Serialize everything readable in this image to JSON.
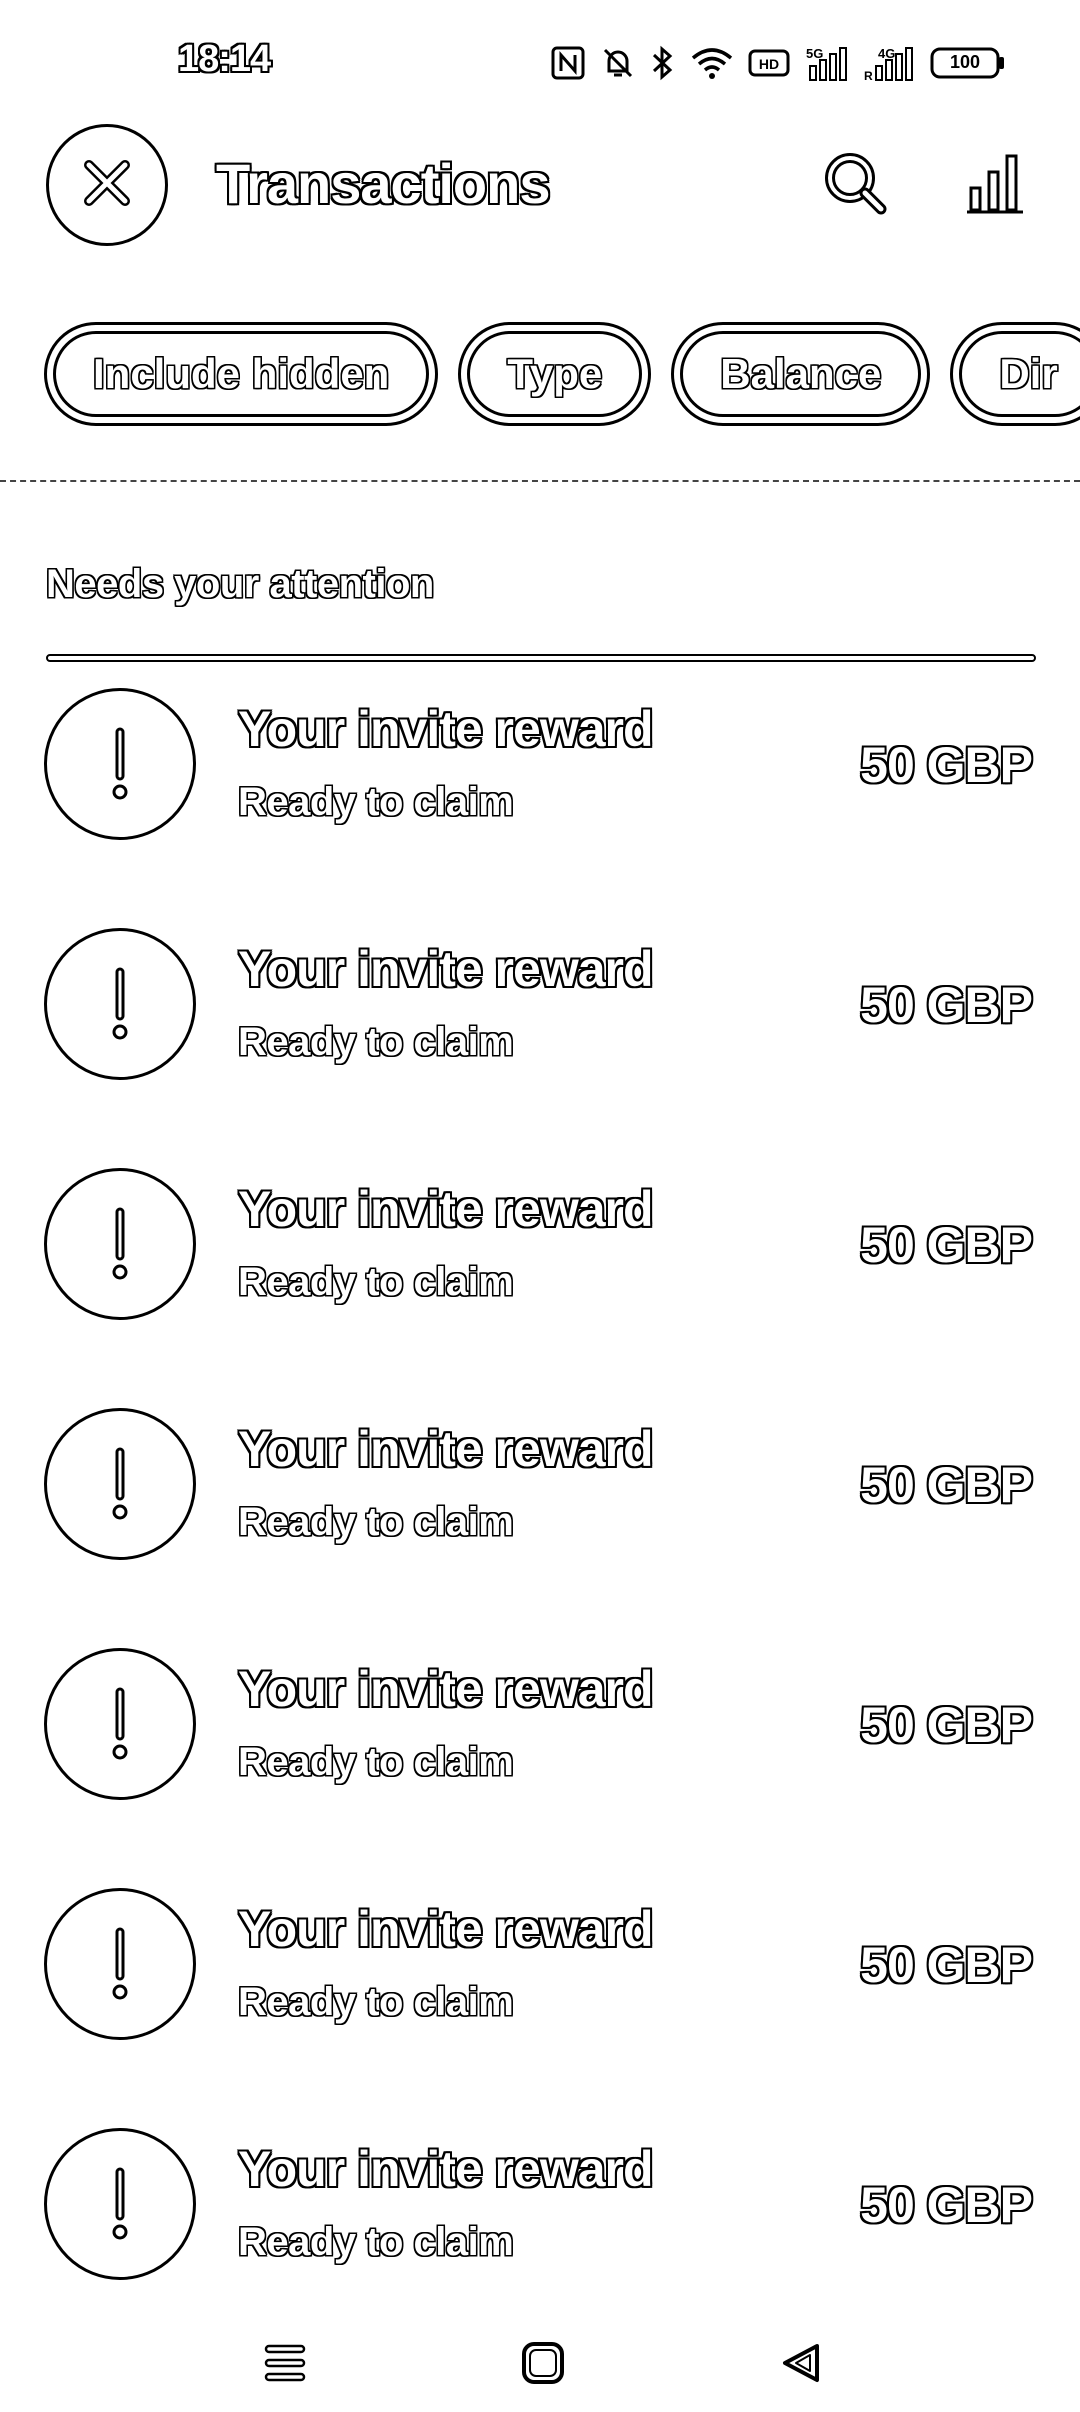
{
  "status_bar": {
    "time": "18:14",
    "icons": [
      "nfc-icon",
      "mute-icon",
      "bluetooth-icon",
      "wifi-icon",
      "hd-icon",
      "signal-5g-icon",
      "signal-4g-icon",
      "battery-icon"
    ],
    "battery": "100"
  },
  "app_bar": {
    "title": "Transactions"
  },
  "filters": [
    "Include hidden",
    "Type",
    "Balance",
    "Dir"
  ],
  "section": {
    "title": "Needs your attention"
  },
  "transactions": [
    {
      "title": "Your invite reward",
      "subtitle": "Ready to claim",
      "amount": "50 GBP"
    },
    {
      "title": "Your invite reward",
      "subtitle": "Ready to claim",
      "amount": "50 GBP"
    },
    {
      "title": "Your invite reward",
      "subtitle": "Ready to claim",
      "amount": "50 GBP"
    },
    {
      "title": "Your invite reward",
      "subtitle": "Ready to claim",
      "amount": "50 GBP"
    },
    {
      "title": "Your invite reward",
      "subtitle": "Ready to claim",
      "amount": "50 GBP"
    },
    {
      "title": "Your invite reward",
      "subtitle": "Ready to claim",
      "amount": "50 GBP"
    },
    {
      "title": "Your invite reward",
      "subtitle": "Ready to claim",
      "amount": "50 GBP"
    }
  ],
  "nav": [
    "menu-icon",
    "home-icon",
    "back-icon"
  ]
}
